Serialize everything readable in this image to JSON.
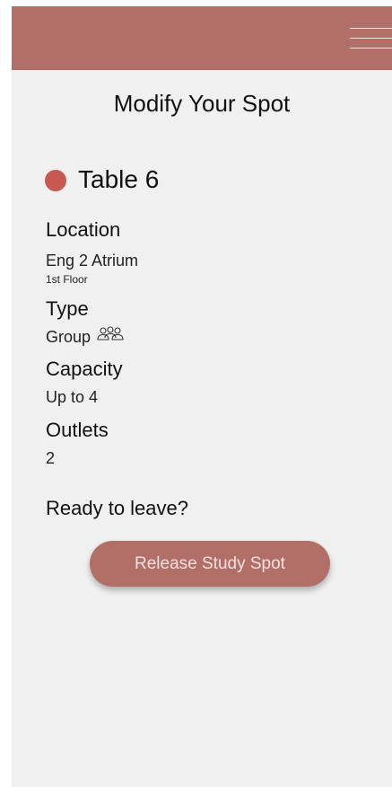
{
  "colors": {
    "header": "#b16f68",
    "status_dot": "#c75852",
    "button": "#b16f68",
    "background": "#f0f0f0"
  },
  "header": {
    "menu_icon": "hamburger-menu-icon"
  },
  "page": {
    "title": "Modify Your Spot"
  },
  "spot": {
    "status_icon": "status-dot-icon",
    "name": "Table 6",
    "location": {
      "label": "Location",
      "value": "Eng 2 Atrium",
      "floor": "1st Floor"
    },
    "type": {
      "label": "Type",
      "value": "Group",
      "icon": "group-people-icon"
    },
    "capacity": {
      "label": "Capacity",
      "value": "Up to 4"
    },
    "outlets": {
      "label": "Outlets",
      "value": "2"
    }
  },
  "leave": {
    "prompt": "Ready to leave?",
    "button_label": "Release Study Spot"
  }
}
